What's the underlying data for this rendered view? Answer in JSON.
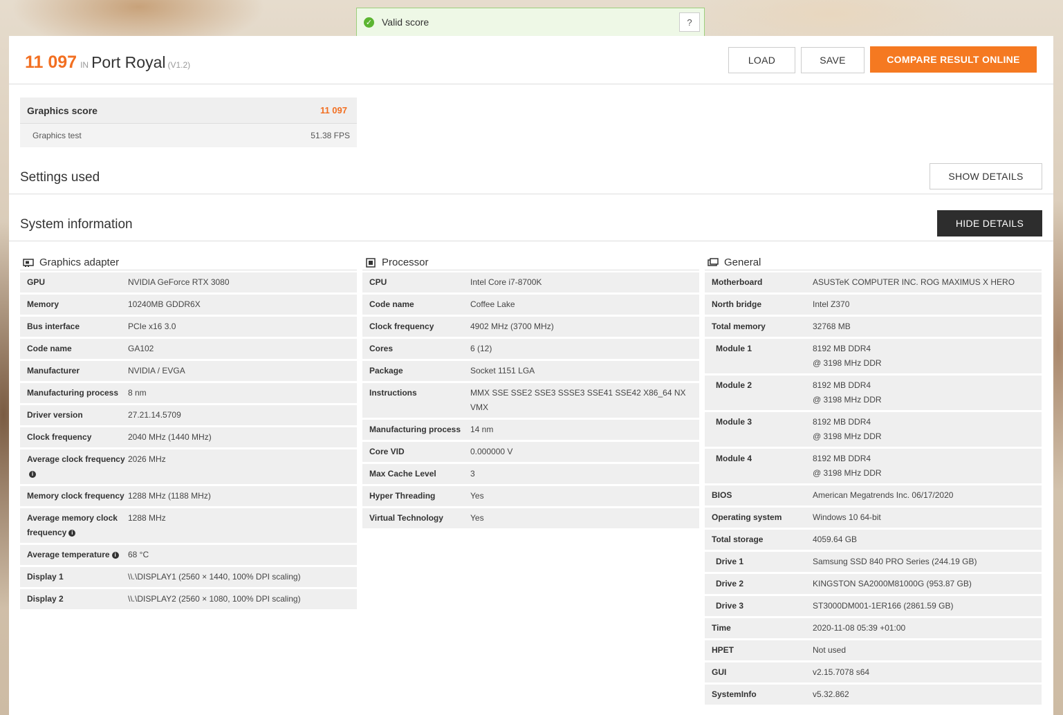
{
  "valid": {
    "text": "Valid score",
    "help": "?"
  },
  "header": {
    "score": "11 097",
    "in": "IN",
    "benchmark": "Port Royal",
    "version": "(V1.2)",
    "load": "LOAD",
    "save": "SAVE",
    "compare": "COMPARE RESULT ONLINE"
  },
  "scores": {
    "graphics_label": "Graphics score",
    "graphics_value": "11 097",
    "test_label": "Graphics test",
    "test_value": "51.38 FPS"
  },
  "settings": {
    "title": "Settings used",
    "button": "SHOW DETAILS"
  },
  "system": {
    "title": "System information",
    "button": "HIDE DETAILS"
  },
  "gpu": {
    "title": "Graphics adapter",
    "rows": [
      {
        "k": "GPU",
        "v": "NVIDIA GeForce RTX 3080"
      },
      {
        "k": "Memory",
        "v": "10240MB GDDR6X"
      },
      {
        "k": "Bus interface",
        "v": "PCIe x16 3.0"
      },
      {
        "k": "Code name",
        "v": "GA102"
      },
      {
        "k": "Manufacturer",
        "v": "NVIDIA / EVGA"
      },
      {
        "k": "Manufacturing process",
        "v": "8 nm"
      },
      {
        "k": "Driver version",
        "v": "27.21.14.5709"
      },
      {
        "k": "Clock frequency",
        "v": "2040 MHz (1440 MHz)"
      },
      {
        "k": "Average clock frequency",
        "v": "2026 MHz",
        "info": true
      },
      {
        "k": "Memory clock frequency",
        "v": "1288 MHz (1188 MHz)"
      },
      {
        "k": "Average memory clock frequency",
        "v": "1288 MHz",
        "info": true
      },
      {
        "k": "Average temperature",
        "v": "68 °C",
        "info": true
      },
      {
        "k": "Display 1",
        "v": "\\\\.\\DISPLAY1 (2560 × 1440, 100% DPI scaling)"
      },
      {
        "k": "Display 2",
        "v": "\\\\.\\DISPLAY2 (2560 × 1080, 100% DPI scaling)"
      }
    ]
  },
  "cpu": {
    "title": "Processor",
    "rows": [
      {
        "k": "CPU",
        "v": "Intel Core i7-8700K"
      },
      {
        "k": "Code name",
        "v": "Coffee Lake"
      },
      {
        "k": "Clock frequency",
        "v": "4902 MHz (3700 MHz)"
      },
      {
        "k": "Cores",
        "v": "6 (12)"
      },
      {
        "k": "Package",
        "v": "Socket 1151 LGA"
      },
      {
        "k": "Instructions",
        "v": "MMX SSE SSE2 SSE3 SSSE3 SSE41 SSE42 X86_64 NX VMX"
      },
      {
        "k": "Manufacturing process",
        "v": "14 nm"
      },
      {
        "k": "Core VID",
        "v": "0.000000 V"
      },
      {
        "k": "Max Cache Level",
        "v": "3"
      },
      {
        "k": "Hyper Threading",
        "v": "Yes"
      },
      {
        "k": "Virtual Technology",
        "v": "Yes"
      }
    ]
  },
  "general": {
    "title": "General",
    "rows": [
      {
        "k": "Motherboard",
        "v": "ASUSTeK COMPUTER INC. ROG MAXIMUS X HERO"
      },
      {
        "k": "North bridge",
        "v": "Intel Z370"
      },
      {
        "k": "Total memory",
        "v": "32768 MB"
      },
      {
        "k": "Module 1",
        "v": "8192 MB DDR4\n@ 3198 MHz DDR",
        "sub": true
      },
      {
        "k": "Module 2",
        "v": "8192 MB DDR4\n@ 3198 MHz DDR",
        "sub": true
      },
      {
        "k": "Module 3",
        "v": "8192 MB DDR4\n@ 3198 MHz DDR",
        "sub": true
      },
      {
        "k": "Module 4",
        "v": "8192 MB DDR4\n@ 3198 MHz DDR",
        "sub": true
      },
      {
        "k": "BIOS",
        "v": "American Megatrends Inc. 06/17/2020"
      },
      {
        "k": "Operating system",
        "v": "Windows 10 64-bit"
      },
      {
        "k": "Total storage",
        "v": "4059.64 GB"
      },
      {
        "k": "Drive 1",
        "v": "Samsung SSD 840 PRO Series (244.19 GB)",
        "sub": true
      },
      {
        "k": "Drive 2",
        "v": "KINGSTON SA2000M81000G (953.87 GB)",
        "sub": true
      },
      {
        "k": "Drive 3",
        "v": "ST3000DM001-1ER166 (2861.59 GB)",
        "sub": true
      },
      {
        "k": "Time",
        "v": "2020-11-08 05:39 +01:00"
      },
      {
        "k": "HPET",
        "v": "Not used"
      },
      {
        "k": "GUI",
        "v": "v2.15.7078 s64"
      },
      {
        "k": "SystemInfo",
        "v": "v5.32.862"
      }
    ]
  }
}
